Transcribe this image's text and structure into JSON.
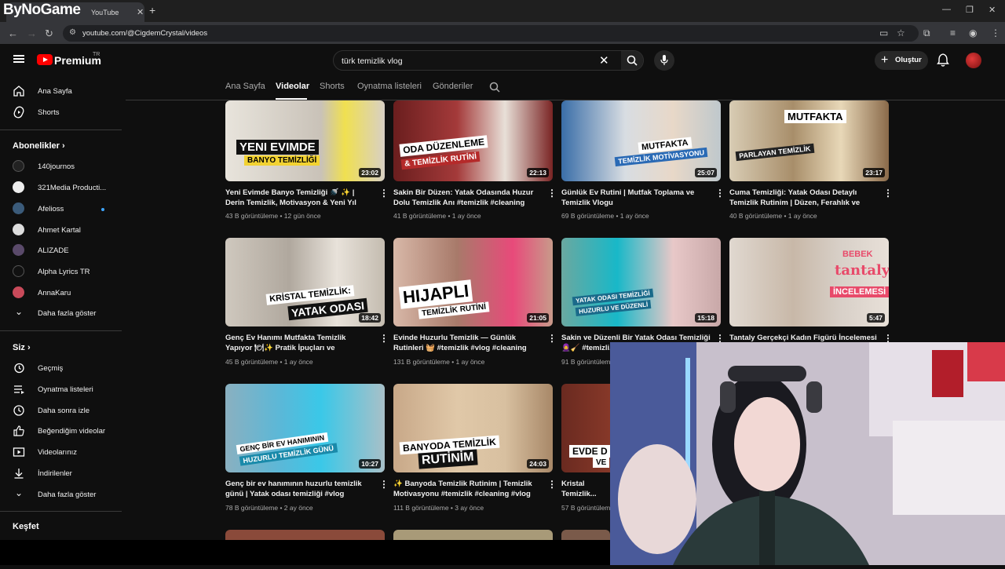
{
  "browser": {
    "watermark": "ByNoGame",
    "tab_title": "YouTube",
    "url": "youtube.com/@CigdemCrystal/videos"
  },
  "header": {
    "brand": "Premium",
    "brand_region": "TR",
    "search_value": "türk temizlik vlog",
    "create_label": "Oluştur"
  },
  "sidebar": {
    "main": [
      {
        "label": "Ana Sayfa",
        "icon": "home-icon"
      },
      {
        "label": "Shorts",
        "icon": "shorts-icon"
      }
    ],
    "subs_heading": "Abonelikler",
    "subs": [
      {
        "label": "140journos",
        "color": "#222"
      },
      {
        "label": "321Media Producti...",
        "color": "#eee"
      },
      {
        "label": "Afelioss",
        "color": "#3b5b7a",
        "dot": true
      },
      {
        "label": "Ahmet Kartal",
        "color": "#ddd"
      },
      {
        "label": "ALIZADE",
        "color": "#5a4a6a"
      },
      {
        "label": "Alpha Lyrics TR",
        "color": "#111"
      },
      {
        "label": "AnnaKaru",
        "color": "#c84a5a"
      }
    ],
    "subs_more": "Daha fazla göster",
    "you_heading": "Siz",
    "you": [
      {
        "label": "Geçmiş",
        "icon": "history-icon"
      },
      {
        "label": "Oynatma listeleri",
        "icon": "playlist-icon"
      },
      {
        "label": "Daha sonra izle",
        "icon": "watch-later-icon"
      },
      {
        "label": "Beğendiğim videolar",
        "icon": "like-icon"
      },
      {
        "label": "Videolarınız",
        "icon": "your-videos-icon"
      },
      {
        "label": "İndirilenler",
        "icon": "download-icon"
      },
      {
        "label": "Daha fazla göster",
        "icon": "chevron-down-icon"
      }
    ],
    "explore_heading": "Keşfet"
  },
  "channel_tabs": [
    "Ana Sayfa",
    "Videolar",
    "Shorts",
    "Oynatma listeleri",
    "Gönderiler"
  ],
  "videos": [
    {
      "title": "Yeni Evimde Banyo Temizliği 🚿 ✨ | Derin Temizlik, Motivasyon & Yeni Yıl Mesajı...",
      "meta": "43 B görüntüleme • 12 gün önce",
      "duration": "23:02",
      "overlay1": "YENI EVIMDE",
      "overlay2": "BANYO TEMİZLİĞİ",
      "bg": "#d8d3c9"
    },
    {
      "title": "Sakin Bir Düzen: Yatak Odasında Huzur Dolu Temizlik Anı #temizlik #cleaning #vlog...",
      "meta": "41 B görüntüleme • 1 ay önce",
      "duration": "22:13",
      "overlay1": "ODA DÜZENLEME",
      "overlay2": "& TEMİZLİK RUTİNİ",
      "bg": "#8a2a2a"
    },
    {
      "title": "Günlük Ev Rutini | Mutfak Toplama ve Temizlik Vlogu",
      "meta": "69 B görüntüleme • 1 ay önce",
      "duration": "25:07",
      "overlay1": "MUTFAKTA",
      "overlay2": "TEMİZLİK MOTİVASYONU",
      "bg": "#c9d6de"
    },
    {
      "title": "Cuma Temizliği: Yatak Odası Detaylı Temizlik Rutinim | Düzen, Ferahlık ve Motivasyon...",
      "meta": "40 B görüntüleme • 1 ay önce",
      "duration": "23:17",
      "overlay1": "MUTFAKTA",
      "overlay2": "PARLAYAN TEMİZLİK",
      "bg": "#cdbfa8"
    },
    {
      "title": "Genç Ev Hanımı Mutfakta Temizlik Yapıyor 🍽✨ Pratik İpuçları ve Motivasyon #vlog...",
      "meta": "45 B görüntüleme • 1 ay önce",
      "duration": "18:42",
      "overlay1": "KRİSTAL TEMİZLİK:",
      "overlay2": "YATAK ODASI",
      "bg": "#c7c1b8"
    },
    {
      "title": "Evinde Huzurlu Temizlik — Günlük Rutinleri 🧺 #temizlik #vlog #cleaning",
      "meta": "131 B görüntüleme • 1 ay önce",
      "duration": "21:05",
      "overlay1": "HIJAPLI",
      "overlay2": "TEMİZLİK RUTİNİ",
      "bg": "#b88a7a"
    },
    {
      "title": "Sakin ve Düzenli Bir Yatak Odası Temizliği 🧕🧹 #temizli...",
      "meta": "91 B görüntüleme",
      "duration": "15:18",
      "overlay1": "YATAK ODASI TEMİZLİĞİ",
      "overlay2": "HUZURLU VE DÜZENLİ",
      "bg": "#8fb8b0"
    },
    {
      "title": "Tantaly Gerçekçi Kadın Figürü İncelemesi |",
      "meta": "",
      "duration": "5:47",
      "overlay1": "BEBEK",
      "overlay2": "İNCELEMESİ",
      "overlay3": "tantaly",
      "bg": "#d9d2cc"
    },
    {
      "title": "Genç bir ev hanımının huzurlu temizlik günü | Yatak odası temizliği #vlog #temizlik...",
      "meta": "78 B görüntüleme • 2 ay önce",
      "duration": "10:27",
      "overlay1": "GENÇ BİR EV HANIMININ",
      "overlay2": "HUZURLU TEMİZLİK GÜNÜ",
      "bg": "#9fb7c4"
    },
    {
      "title": "✨ Banyoda Temizlik Rutinim | Temizlik Motivasyonu #temizlik #cleaning #vlog",
      "meta": "111 B görüntüleme • 3 ay önce",
      "duration": "24:03",
      "overlay1": "BANYODA TEMİZLİK",
      "overlay2": "RUTİNİM",
      "bg": "#c8ad8c"
    },
    {
      "title": "Kristal Temizlik... #temizlik #vlog",
      "meta": "57 B görüntüleme",
      "duration": "",
      "overlay1": "EVDE D",
      "overlay2": "VE",
      "bg": "#6a2a20"
    }
  ]
}
